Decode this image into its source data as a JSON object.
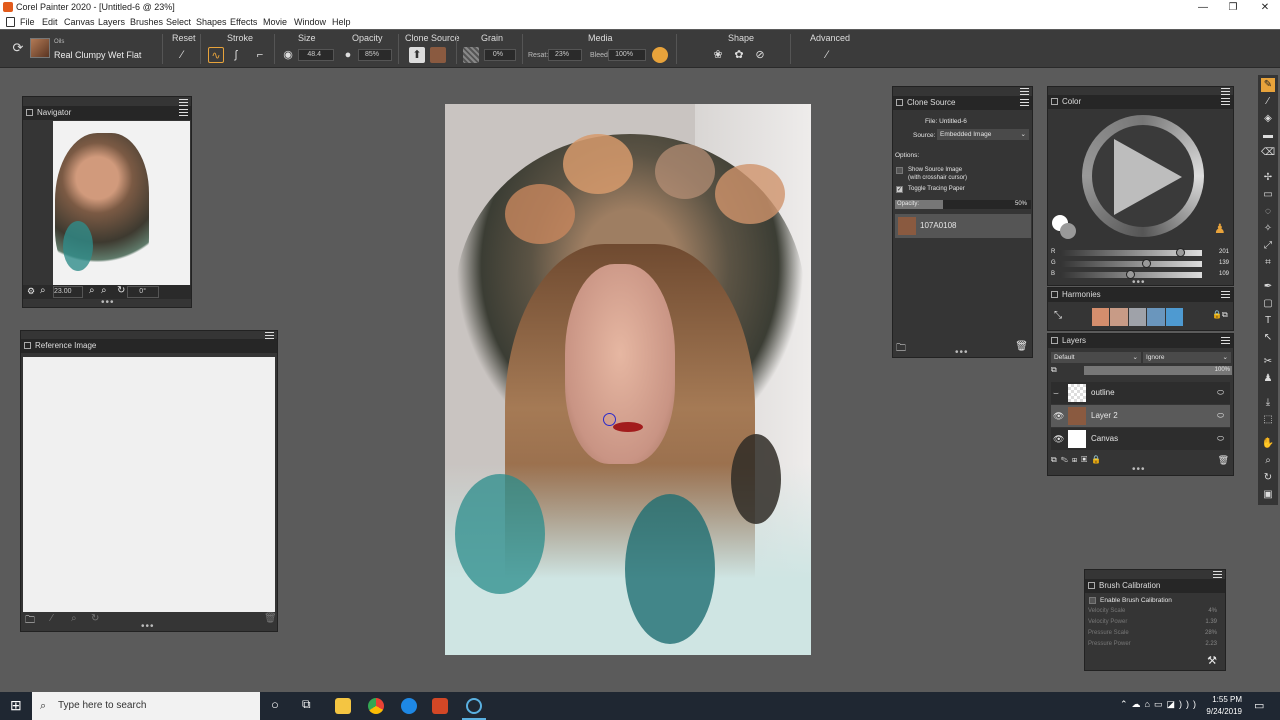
{
  "window": {
    "title": "Corel Painter 2020 - [Untitled-6 @ 23%]",
    "controls": [
      "—",
      "❐",
      "✕"
    ]
  },
  "menu": [
    "File",
    "Edit",
    "Canvas",
    "Layers",
    "Brushes",
    "Select",
    "Shapes",
    "Effects",
    "Movie",
    "Window",
    "Help"
  ],
  "propbar": {
    "category": "Oils",
    "variant": "Real Clumpy Wet Flat",
    "labels": {
      "reset": "Reset",
      "stroke": "Stroke",
      "size": "Size",
      "opacity": "Opacity",
      "clone_source": "Clone Source",
      "grain": "Grain",
      "media": "Media",
      "shape": "Shape",
      "advanced": "Advanced"
    },
    "size_value": "48.4",
    "opacity_value": "85%",
    "grain_value": "0%",
    "media_resat_label": "Resat:",
    "media_resat_value": "23%",
    "media_bleed_label": "Bleed:",
    "media_bleed_value": "100%"
  },
  "navigator": {
    "title": "Navigator",
    "zoom": "23.00",
    "rotation": "0°"
  },
  "reference_image": {
    "title": "Reference Image"
  },
  "clone_source": {
    "title": "Clone Source",
    "file": "File: Untitled-6",
    "source_label": "Source:",
    "source_value": "Embedded Image",
    "options_label": "Options:",
    "show_source": "Show Source Image",
    "show_source_sub": "(with crosshair cursor)",
    "toggle_tracing": "Toggle Tracing Paper",
    "opacity_label": "Opacity:",
    "opacity_value": "50%",
    "source_item": "107A0108"
  },
  "color": {
    "title": "Color",
    "r_label": "R",
    "g_label": "G",
    "b_label": "B",
    "r": "201",
    "g": "139",
    "b": "109",
    "current_color": "#c98b6d"
  },
  "harmonies": {
    "title": "Harmonies",
    "swatches": [
      "#d58e6d",
      "#c89b86",
      "#9fa2a9",
      "#6a96bd",
      "#4e9ad1"
    ]
  },
  "layers": {
    "title": "Layers",
    "composite": "Default",
    "method": "Ignore",
    "opacity": "100%",
    "items": [
      {
        "name": "outline"
      },
      {
        "name": "Layer 2"
      },
      {
        "name": "Canvas"
      }
    ]
  },
  "brush_calibration": {
    "title": "Brush Calibration",
    "enable": "Enable Brush Calibration",
    "rows": [
      {
        "label": "Velocity Scale",
        "value": "4%"
      },
      {
        "label": "Velocity Power",
        "value": "1.39"
      },
      {
        "label": "Pressure Scale",
        "value": "28%"
      },
      {
        "label": "Pressure Power",
        "value": "2.23"
      }
    ]
  },
  "taskbar": {
    "search_placeholder": "Type here to search",
    "time": "1:55 PM",
    "date": "9/24/2019"
  }
}
